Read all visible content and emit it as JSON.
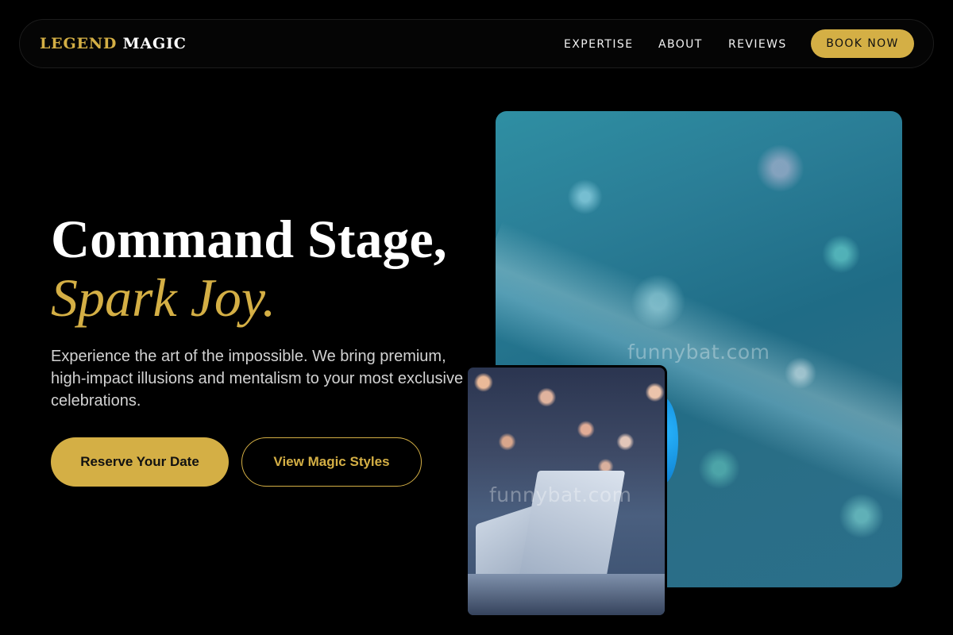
{
  "brand": {
    "part1": "LEGEND",
    "part2": "MAGIC",
    "accent_color": "#d4af45"
  },
  "nav": {
    "links": [
      "EXPERTISE",
      "ABOUT",
      "REVIEWS"
    ],
    "cta": "BOOK NOW"
  },
  "hero": {
    "headline": "Command Stage,",
    "headline_accent": "Spark Joy.",
    "description": "Experience the art of the impossible. We bring premium, high-impact illusions and mentalism to your most exclusive celebrations.",
    "primary_button": "Reserve Your Date",
    "secondary_button": "View Magic Styles"
  },
  "images": {
    "main_icon": "glitter-photo",
    "secondary_icon": "open-book-bokeh-photo",
    "watermark": "funnybat.com"
  }
}
